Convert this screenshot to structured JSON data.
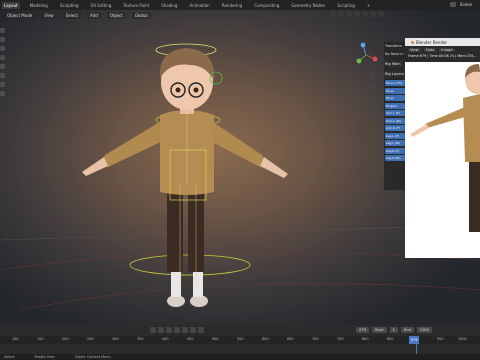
{
  "topbar": {
    "tabs": [
      "Layout",
      "Modeling",
      "Sculpting",
      "UV Editing",
      "Texture Paint",
      "Shading",
      "Animation",
      "Rendering",
      "Compositing",
      "Geometry Nodes",
      "Scripting",
      "+"
    ],
    "active_tab": "Layout",
    "scene_label": "Scene"
  },
  "viewport": {
    "mode": "Object Mode",
    "view_label": "View",
    "select_label": "Select",
    "add_label": "Add",
    "object_label": "Object",
    "transform": "Global"
  },
  "npanel": {
    "sections": [
      "Transform",
      "No Bone in",
      "Rig Main",
      "Rig Layers"
    ],
    "bone_buttons": [
      "Face.L (Fk)",
      "Torso",
      "Torso",
      "Fingers",
      "Arm.L (F)",
      "Arm.L (IK)",
      "Arm.R (F)",
      "Leg.L (F)",
      "Leg.L (IK)",
      "Leg.R (F)",
      "Leg.R (IK)"
    ]
  },
  "render_window": {
    "title": "Blender Render",
    "menu": [
      "View",
      "Slots",
      "Image"
    ],
    "status": "Frame:979 | Time:00:08.74 | Mem:155..."
  },
  "timeline": {
    "current_frame": "979",
    "start_label": "Start",
    "start_value": "1",
    "end_label": "End",
    "end_value": "1000",
    "ticks": [
      "100",
      "150",
      "200",
      "250",
      "300",
      "350",
      "400",
      "450",
      "500",
      "550",
      "600",
      "650",
      "700",
      "750",
      "800",
      "850",
      "900",
      "950",
      "1000"
    ],
    "cursor_frame": "979"
  },
  "statusbar": {
    "left": "Select",
    "middle": "Rotate View",
    "right": "Object Context Menu"
  }
}
